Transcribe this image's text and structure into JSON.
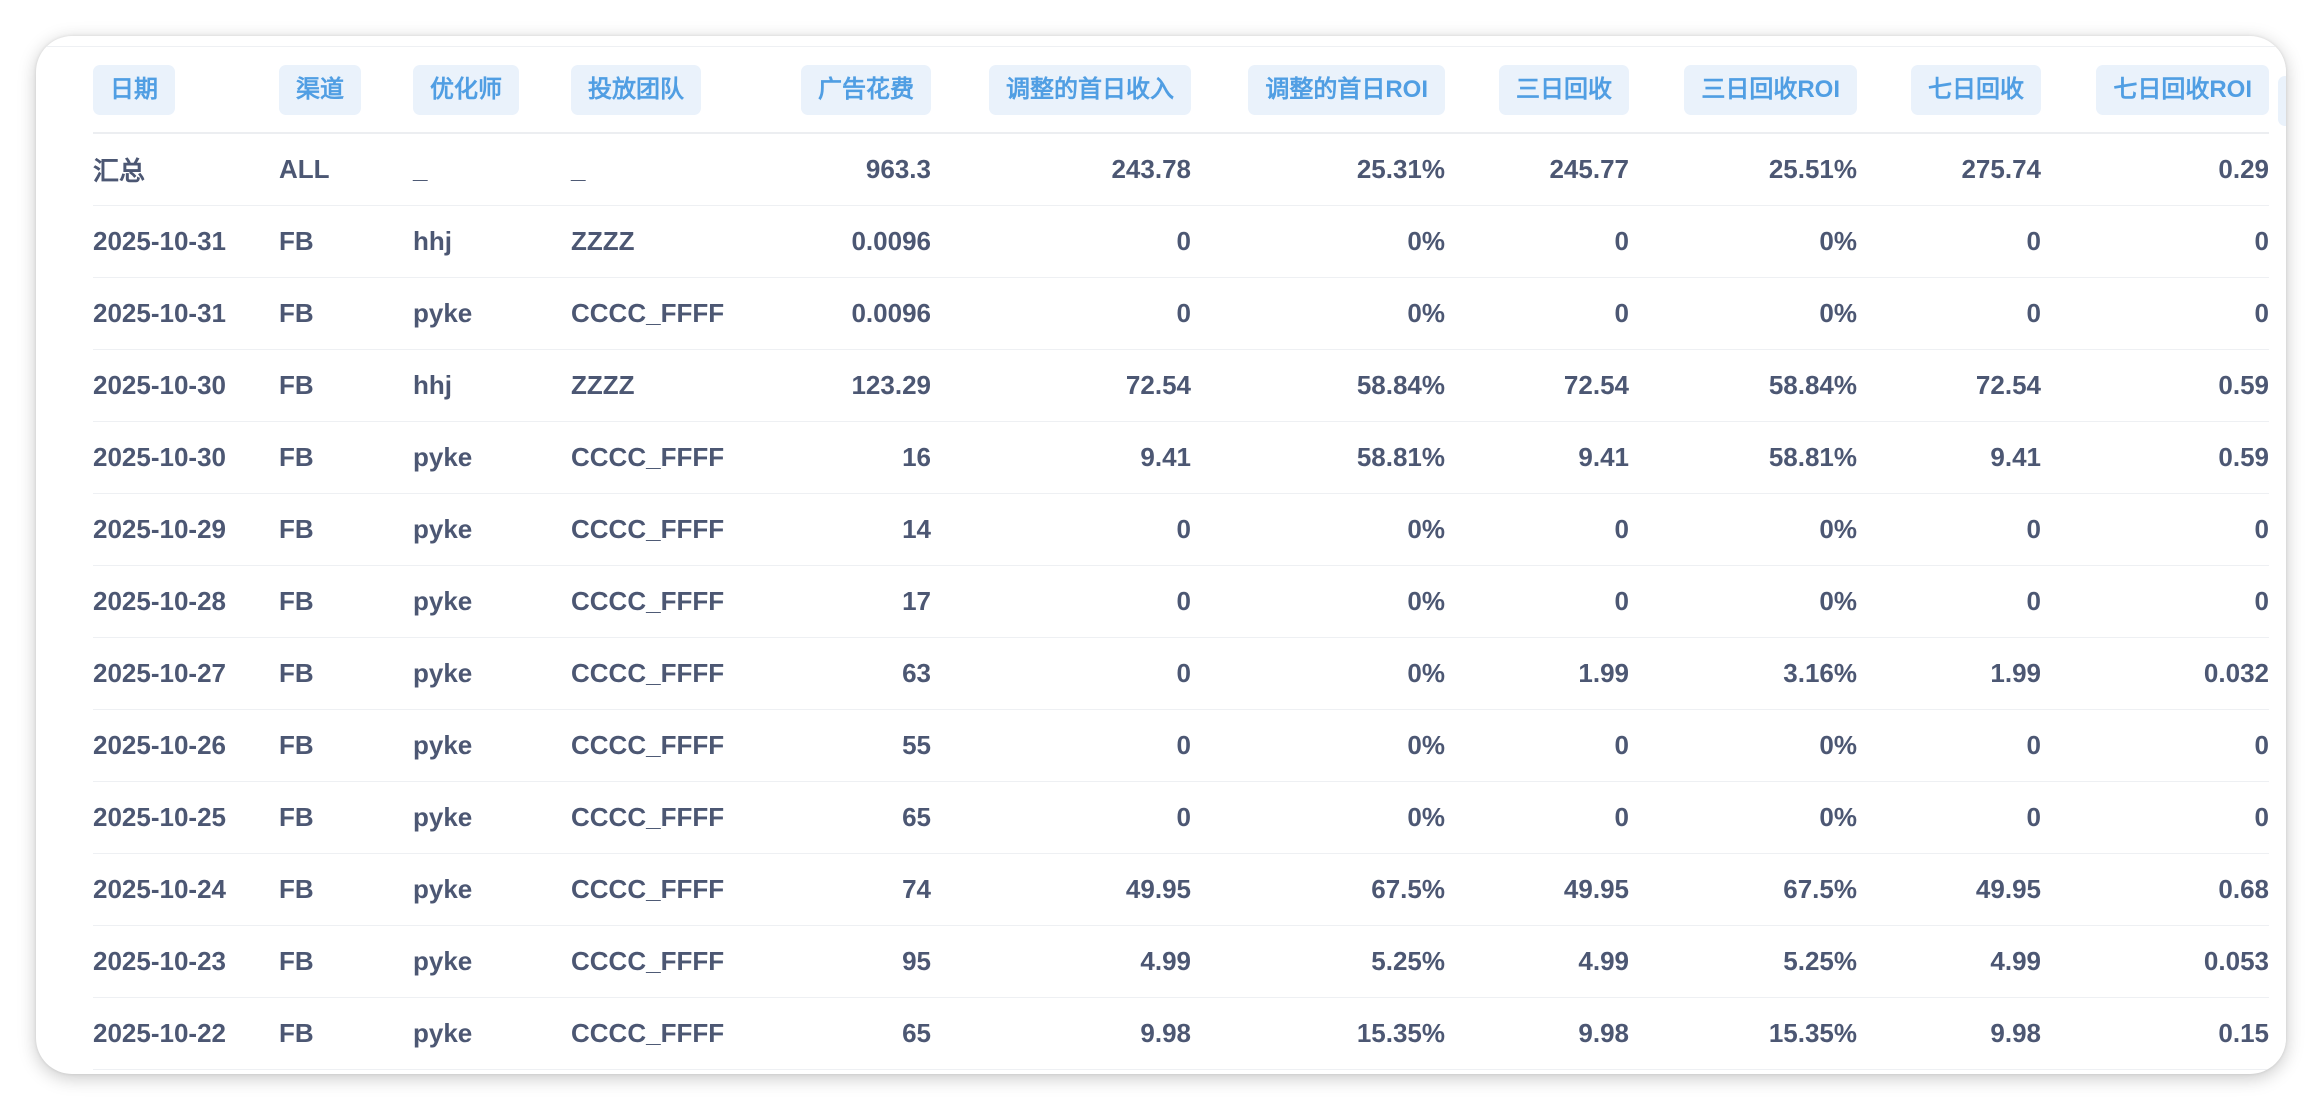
{
  "table": {
    "columns": [
      {
        "key": "date",
        "label": "日期",
        "align": "left"
      },
      {
        "key": "channel",
        "label": "渠道",
        "align": "left"
      },
      {
        "key": "optimizer",
        "label": "优化师",
        "align": "left"
      },
      {
        "key": "team",
        "label": "投放团队",
        "align": "left"
      },
      {
        "key": "ad_spend",
        "label": "广告花费",
        "align": "right"
      },
      {
        "key": "adj_d1_revenue",
        "label": "调整的首日收入",
        "align": "right"
      },
      {
        "key": "adj_d1_roi",
        "label": "调整的首日ROI",
        "align": "right"
      },
      {
        "key": "d3_return",
        "label": "三日回收",
        "align": "right"
      },
      {
        "key": "d3_roi",
        "label": "三日回收ROI",
        "align": "right"
      },
      {
        "key": "d7_return",
        "label": "七日回收",
        "align": "right"
      },
      {
        "key": "d7_roi",
        "label": "七日回收ROI",
        "align": "right"
      }
    ],
    "rows": [
      [
        "汇总",
        "ALL",
        "_",
        "_",
        "963.3",
        "243.78",
        "25.31%",
        "245.77",
        "25.51%",
        "275.74",
        "0.29"
      ],
      [
        "2025-10-31",
        "FB",
        "hhj",
        "ZZZZ",
        "0.0096",
        "0",
        "0%",
        "0",
        "0%",
        "0",
        "0"
      ],
      [
        "2025-10-31",
        "FB",
        "pyke",
        "CCCC_FFFF",
        "0.0096",
        "0",
        "0%",
        "0",
        "0%",
        "0",
        "0"
      ],
      [
        "2025-10-30",
        "FB",
        "hhj",
        "ZZZZ",
        "123.29",
        "72.54",
        "58.84%",
        "72.54",
        "58.84%",
        "72.54",
        "0.59"
      ],
      [
        "2025-10-30",
        "FB",
        "pyke",
        "CCCC_FFFF",
        "16",
        "9.41",
        "58.81%",
        "9.41",
        "58.81%",
        "9.41",
        "0.59"
      ],
      [
        "2025-10-29",
        "FB",
        "pyke",
        "CCCC_FFFF",
        "14",
        "0",
        "0%",
        "0",
        "0%",
        "0",
        "0"
      ],
      [
        "2025-10-28",
        "FB",
        "pyke",
        "CCCC_FFFF",
        "17",
        "0",
        "0%",
        "0",
        "0%",
        "0",
        "0"
      ],
      [
        "2025-10-27",
        "FB",
        "pyke",
        "CCCC_FFFF",
        "63",
        "0",
        "0%",
        "1.99",
        "3.16%",
        "1.99",
        "0.032"
      ],
      [
        "2025-10-26",
        "FB",
        "pyke",
        "CCCC_FFFF",
        "55",
        "0",
        "0%",
        "0",
        "0%",
        "0",
        "0"
      ],
      [
        "2025-10-25",
        "FB",
        "pyke",
        "CCCC_FFFF",
        "65",
        "0",
        "0%",
        "0",
        "0%",
        "0",
        "0"
      ],
      [
        "2025-10-24",
        "FB",
        "pyke",
        "CCCC_FFFF",
        "74",
        "49.95",
        "67.5%",
        "49.95",
        "67.5%",
        "49.95",
        "0.68"
      ],
      [
        "2025-10-23",
        "FB",
        "pyke",
        "CCCC_FFFF",
        "95",
        "4.99",
        "5.25%",
        "4.99",
        "5.25%",
        "4.99",
        "0.053"
      ],
      [
        "2025-10-22",
        "FB",
        "pyke",
        "CCCC_FFFF",
        "65",
        "9.98",
        "15.35%",
        "9.98",
        "15.35%",
        "9.98",
        "0.15"
      ]
    ]
  },
  "colors": {
    "header_pill_bg": "#eaf2fb",
    "header_text": "#509ee3",
    "cell_text": "#4c5773",
    "row_divider": "#eef0f3"
  }
}
